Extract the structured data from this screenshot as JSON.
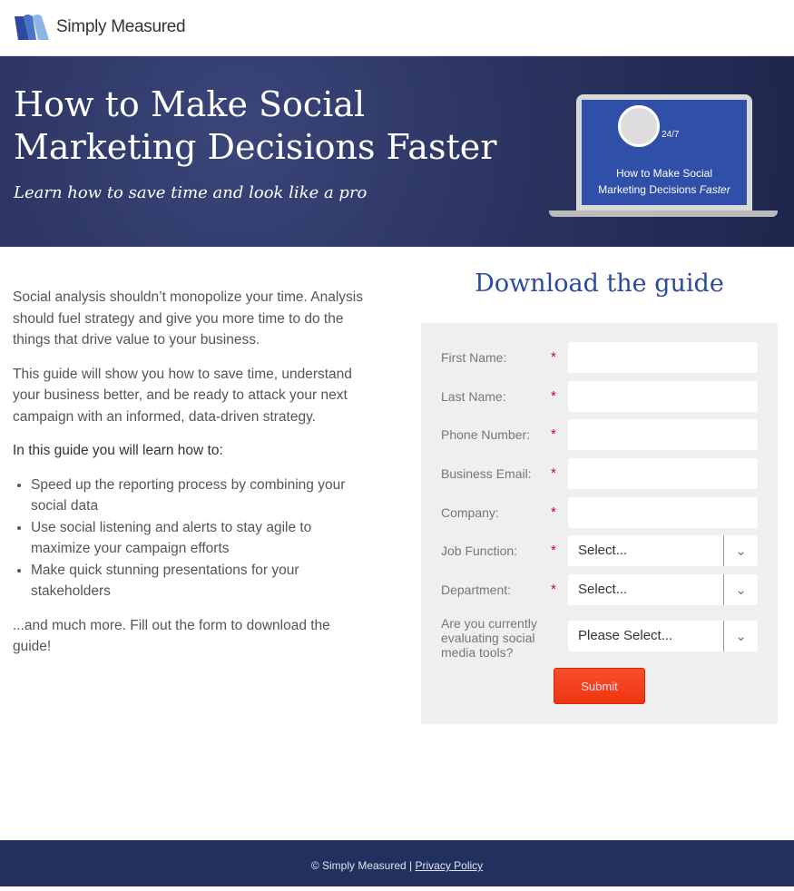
{
  "header": {
    "brand": "Simply Measured"
  },
  "hero": {
    "title": "How to Make Social Marketing Decisions Faster",
    "subtitle": "Learn how to save time and look like a pro",
    "book_cover_line1": "How to Make Social",
    "book_cover_line2": "Marketing Decisions",
    "book_cover_emph": "Faster",
    "book_cover_badge": "24/7"
  },
  "intro": {
    "p1": "Social analysis shouldn’t monopolize your time. Analysis should fuel strategy and give you more time to do the things that drive value to your business.",
    "p2": "This guide will show you how to save time, understand your business better, and be ready to attack your next campaign with an informed, data-driven strategy.",
    "learn_heading": "In this guide you will learn how to:",
    "bullets": [
      "Speed up the reporting process by combining your social data",
      "Use social listening and alerts to stay agile to maximize your campaign efforts",
      "Make quick stunning presentations for your stakeholders"
    ],
    "closing": "...and much more. Fill out the form to download the guide!"
  },
  "form": {
    "title": "Download the guide",
    "required_mark": "*",
    "fields": [
      {
        "label": "First Name:",
        "value": ""
      },
      {
        "label": "Last Name:",
        "value": ""
      },
      {
        "label": "Phone Number:",
        "value": ""
      },
      {
        "label": "Business Email:",
        "value": ""
      },
      {
        "label": "Company:",
        "value": ""
      }
    ],
    "selects": [
      {
        "label": "Job Function:",
        "value": "Select..."
      },
      {
        "label": "Department:",
        "value": "Select..."
      },
      {
        "label": "Are you currently evaluating social media tools?",
        "value": "Please Select..."
      }
    ],
    "submit": "Submit"
  },
  "footer": {
    "copyright": "© Simply Measured |",
    "privacy": "Privacy Policy"
  },
  "colors": {
    "hero_bg": "#28305c",
    "accent": "#2b4a9e",
    "submit": "#f03c12",
    "footer": "#22305f"
  }
}
